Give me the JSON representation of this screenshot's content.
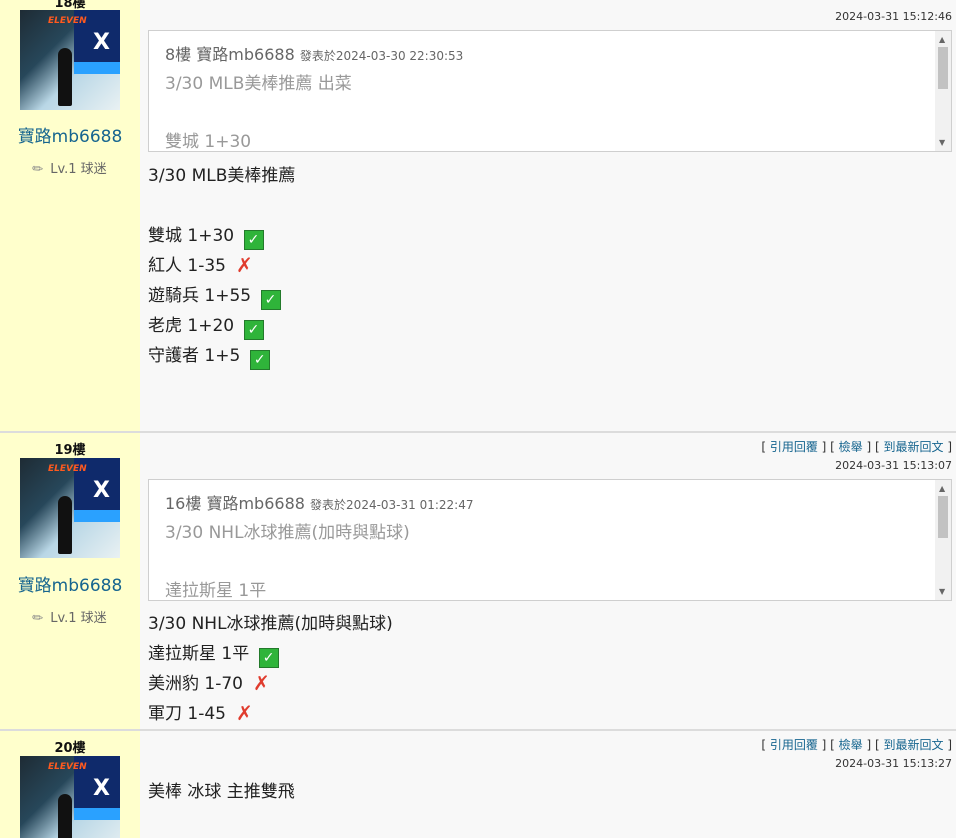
{
  "posts": [
    {
      "floor": "18樓",
      "username": "寶路mb6688",
      "level": "Lv.1 球迷",
      "timestamp": "2024-03-31 15:12:46",
      "quote": {
        "floor": "8樓",
        "author": "寶路mb6688",
        "posted_prefix": "發表於",
        "posted_time": "2024-03-30 22:30:53",
        "title": "3/30 MLB美棒推薦 出菜",
        "first_line": "雙城 1+30"
      },
      "title": "3/30 MLB美棒推薦",
      "lines": [
        {
          "text": "雙城 1+30",
          "result": "✓"
        },
        {
          "text": "紅人 1-35",
          "result": "✗"
        },
        {
          "text": "遊騎兵 1+55",
          "result": "✓"
        },
        {
          "text": "老虎 1+20",
          "result": "✓"
        },
        {
          "text": "守護者 1+5",
          "result": "✓"
        }
      ]
    },
    {
      "floor": "19樓",
      "username": "寶路mb6688",
      "level": "Lv.1 球迷",
      "links": {
        "quote": "引用回覆",
        "report": "檢舉",
        "latest": "到最新回文"
      },
      "timestamp": "2024-03-31 15:13:07",
      "quote": {
        "floor": "16樓",
        "author": "寶路mb6688",
        "posted_prefix": "發表於",
        "posted_time": "2024-03-31 01:22:47",
        "title": "3/30 NHL冰球推薦(加時與點球)",
        "first_line": "達拉斯星 1平"
      },
      "title": "3/30 NHL冰球推薦(加時與點球)",
      "lines": [
        {
          "text": "達拉斯星 1平",
          "result": "✓"
        },
        {
          "text": "美洲豹 1-70",
          "result": "✗"
        },
        {
          "text": "軍刀 1-45",
          "result": "✗"
        }
      ]
    },
    {
      "floor": "20樓",
      "links": {
        "quote": "引用回覆",
        "report": "檢舉",
        "latest": "到最新回文"
      },
      "timestamp": "2024-03-31 15:13:27",
      "title": "美棒 冰球 主推雙飛"
    }
  ],
  "avatar": {
    "logo": "ELEVEN",
    "mark": "X"
  },
  "colors": {
    "sidebar": "#ffffcc",
    "username": "#16658f",
    "ok": "#2fb43a",
    "bad": "#e03c2e"
  }
}
